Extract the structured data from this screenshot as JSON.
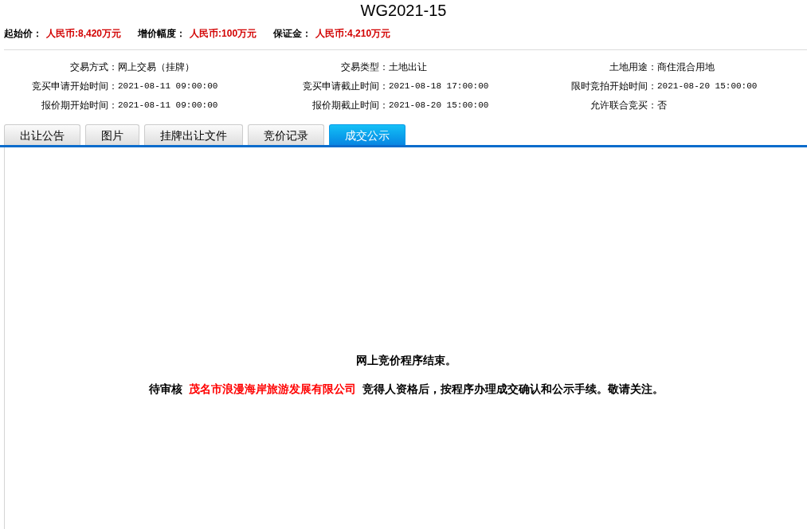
{
  "title": "WG2021-15",
  "price_summary": [
    {
      "label": "起始价：",
      "value": "人民币:8,420万元"
    },
    {
      "label": "增价幅度：",
      "value": "人民币:100万元"
    },
    {
      "label": "保证金：",
      "value": "人民币:4,210万元"
    }
  ],
  "details": [
    {
      "label": "交易方式：",
      "value": "网上交易（挂牌）",
      "kind": "text"
    },
    {
      "label": "交易类型：",
      "value": "土地出让",
      "kind": "text"
    },
    {
      "label": "土地用途：",
      "value": "商住混合用地",
      "kind": "text"
    },
    {
      "label": "竞买申请开始时间：",
      "value": "2021-08-11 09:00:00",
      "kind": "datetime"
    },
    {
      "label": "竞买申请截止时间：",
      "value": "2021-08-18 17:00:00",
      "kind": "datetime"
    },
    {
      "label": "限时竞拍开始时间：",
      "value": "2021-08-20 15:00:00",
      "kind": "datetime"
    },
    {
      "label": "报价期开始时间：",
      "value": "2021-08-11 09:00:00",
      "kind": "datetime"
    },
    {
      "label": "报价期截止时间：",
      "value": "2021-08-20 15:00:00",
      "kind": "datetime"
    },
    {
      "label": "允许联合竞买：",
      "value": "否",
      "kind": "text"
    }
  ],
  "tabs": [
    {
      "label": "出让公告",
      "selected": false
    },
    {
      "label": "图片",
      "selected": false
    },
    {
      "label": "挂牌出让文件",
      "selected": false
    },
    {
      "label": "竞价记录",
      "selected": false
    },
    {
      "label": "成交公示",
      "selected": true
    }
  ],
  "notice": {
    "heading": "网上竞价程序结束。",
    "message_before": "待审核",
    "bidder": "茂名市浪漫海岸旅游发展有限公司",
    "message_after": "竞得人资格后，按程序办理成交确认和公示手续。敬请关注。"
  }
}
